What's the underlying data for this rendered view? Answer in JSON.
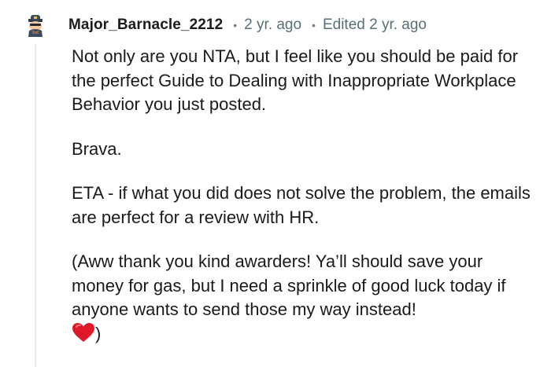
{
  "comment": {
    "author": "Major_Barnacle_2212",
    "separator": "•",
    "posted": "2 yr. ago",
    "edited": "Edited 2 yr. ago",
    "paragraphs": [
      "Not only are you NTA, but I feel like you should be paid for the perfect Guide to Dealing with Inappropriate Workplace Behavior you just posted.",
      "Brava.",
      "ETA - if what you did does not solve the problem, the emails are perfect for a review with HR."
    ],
    "last_paragraph_text": "(Aww thank you kind awarders! Ya’ll should save your money for gas, but I need a sprinkle of good luck today if anyone wants to send those my way instead!",
    "last_paragraph_tail": ")",
    "emoji": "heart-emoji"
  },
  "colors": {
    "username": "#1c1c1c",
    "meta": "#576f76",
    "body_text": "#1a1a1b",
    "thread_line": "#e9ebed",
    "heart": "#e0162b"
  }
}
